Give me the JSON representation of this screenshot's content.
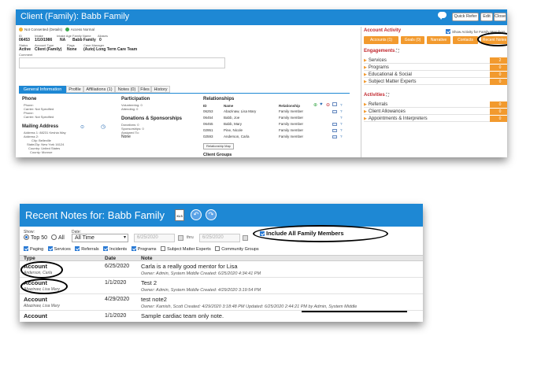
{
  "top": {
    "title": "Client (Family): Babb Family",
    "buttons": {
      "quick_refer": "Quick Refer",
      "edit": "Edit",
      "close": "Close"
    },
    "status": {
      "consent": "Not Consented (Details)",
      "access": "Access Normal"
    },
    "fields": {
      "id_label": "ID",
      "id": "06453",
      "intake_label": "Intake",
      "intake": "1/10/1986",
      "intake_age_label": "Intake Age",
      "intake_age": "NA",
      "family_name_label": "Family Name",
      "family_name": "Babb Family",
      "aliases_label": "Aliases",
      "aliases": "0",
      "status_label": "Status",
      "status": "Active",
      "account_type_label": "Account Type",
      "account_type": "Client (Family)",
      "flags_label": "Flags",
      "flags": "None",
      "case_manager_label": "Case Manager",
      "case_manager": "(Auto) Long Term Care Team",
      "comment_label": "Comment"
    },
    "tabs": [
      "General Information",
      "Profile",
      "Affiliations (1)",
      "Notes (0)",
      "Files",
      "History"
    ],
    "phone": {
      "title": "Phone",
      "lines": [
        "Phone:",
        "Carrier: Not Specified",
        "Phone:",
        "Carrier: Not Specified"
      ]
    },
    "mailing": {
      "title": "Mailing Address",
      "lines": [
        "Address 1: 88231 Keshia Way",
        "Address 2:",
        "City: Belleville",
        "State/Zip: New York 16124",
        "Country: United States",
        "County: Monroe"
      ]
    },
    "participation": {
      "title": "Participation",
      "lines": [
        "Volunteering: 0",
        "Attending: 0"
      ]
    },
    "donations": {
      "title": "Donations & Sponsorships",
      "lines": [
        "Donations: 0",
        "Sponsorships: 0",
        "Assigned To:",
        "None"
      ]
    },
    "relationships": {
      "title": "Relationships",
      "headers": {
        "id": "ID",
        "name": "Name",
        "relationship": "Relationship"
      },
      "rows": [
        {
          "id": "06253",
          "name": "Abazinaw, Lisa Mary",
          "relationship": "Family member"
        },
        {
          "id": "06454",
          "name": "Babb, Joe",
          "relationship": "Family member"
        },
        {
          "id": "06455",
          "name": "Babb, Mary",
          "relationship": "Family member"
        },
        {
          "id": "02951",
          "name": "Pine, Nicole",
          "relationship": "Family member"
        },
        {
          "id": "02593",
          "name": "Anderson, Carla",
          "relationship": "Family member"
        }
      ],
      "map_button": "Relationship Map",
      "client_groups": "Client Groups"
    },
    "right_panel": {
      "account_activity": "Account Activity",
      "show_activity": "Show Activity for Family Members",
      "buttons": [
        "Accounts (1)",
        "Goals (0)",
        "Narrative",
        "Contacts",
        "Recent Notes"
      ],
      "engagements": "Engagements",
      "engagement_items": [
        {
          "label": "Services",
          "count": "2"
        },
        {
          "label": "Programs",
          "count": "0"
        },
        {
          "label": "Educational & Social",
          "count": "0"
        },
        {
          "label": "Subject Matter Experts",
          "count": "0"
        }
      ],
      "activities": "Activities",
      "activity_items": [
        {
          "label": "Referrals",
          "count": "0"
        },
        {
          "label": "Client Allowances",
          "count": "0"
        },
        {
          "label": "Appointments & Interpreters",
          "count": "0"
        }
      ]
    }
  },
  "bottom": {
    "title": "Recent Notes for: Babb Family",
    "xls_label": "XLS",
    "show_label": "Show:",
    "top50": "Top 50",
    "all": "All",
    "date_label": "Date:",
    "date_select": "All Time",
    "date_from": "6/25/2020",
    "thru": "thru",
    "date_to": "6/25/2020",
    "include_all": "Include All Family Members",
    "filters": [
      "Paging",
      "Services",
      "Referrals",
      "Incidents",
      "Programs",
      "Subject Matter Experts",
      "Community Groups"
    ],
    "headers": {
      "type": "Type",
      "date": "Date",
      "note": "Note"
    },
    "notes": [
      {
        "type": "Account",
        "owner": "Anderson, Carla",
        "date": "6/25/2020",
        "text": "Carla is a really good mentor for Lisa",
        "meta": "Owner: Admin, System Middle  Created: 6/25/2020 4:34:41 PM"
      },
      {
        "type": "Account",
        "owner": "Abazinaw, Lisa Mary",
        "date": "1/1/2020",
        "text": "Test 2",
        "meta": "Owner: Admin, System Middle  Created: 4/29/2020 3:19:54 PM"
      },
      {
        "type": "Account",
        "owner": "Abazinaw, Lisa Mary",
        "date": "4/29/2020",
        "text": "test note2",
        "meta": "Owner: Kamish, Scott  Created: 4/29/2020 3:18:48 PM  Updated: 6/25/2020 2:44:21 PM by Admin, System Middle"
      },
      {
        "type": "Account",
        "owner": "",
        "date": "1/1/2020",
        "text": "Sample cardiac team only note.",
        "meta": ""
      }
    ]
  },
  "colors": {
    "header_blue": "#1e88d4",
    "accent_orange": "#f29a2e",
    "section_red": "#c1272d"
  }
}
